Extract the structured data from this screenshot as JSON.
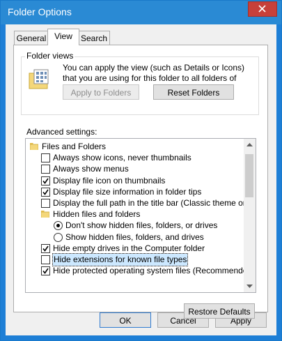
{
  "window": {
    "title": "Folder Options"
  },
  "tabs": [
    {
      "label": "General",
      "active": false
    },
    {
      "label": "View",
      "active": true
    },
    {
      "label": "Search",
      "active": false
    }
  ],
  "folder_views": {
    "legend": "Folder views",
    "description": "You can apply the view (such as Details or Icons) that you are using for this folder to all folders of this type.",
    "apply_label": "Apply to Folders",
    "reset_label": "Reset Folders"
  },
  "advanced": {
    "label": "Advanced settings:",
    "items": [
      {
        "kind": "folder",
        "level": 0,
        "label": "Files and Folders"
      },
      {
        "kind": "checkbox",
        "level": 1,
        "checked": false,
        "label": "Always show icons, never thumbnails"
      },
      {
        "kind": "checkbox",
        "level": 1,
        "checked": false,
        "label": "Always show menus"
      },
      {
        "kind": "checkbox",
        "level": 1,
        "checked": true,
        "label": "Display file icon on thumbnails"
      },
      {
        "kind": "checkbox",
        "level": 1,
        "checked": true,
        "label": "Display file size information in folder tips"
      },
      {
        "kind": "checkbox",
        "level": 1,
        "checked": false,
        "label": "Display the full path in the title bar (Classic theme only)"
      },
      {
        "kind": "folder",
        "level": 1,
        "label": "Hidden files and folders"
      },
      {
        "kind": "radio",
        "level": 2,
        "checked": true,
        "label": "Don't show hidden files, folders, or drives"
      },
      {
        "kind": "radio",
        "level": 2,
        "checked": false,
        "label": "Show hidden files, folders, and drives"
      },
      {
        "kind": "checkbox",
        "level": 1,
        "checked": true,
        "label": "Hide empty drives in the Computer folder"
      },
      {
        "kind": "checkbox",
        "level": 1,
        "checked": false,
        "label": "Hide extensions for known file types",
        "selected": true
      },
      {
        "kind": "checkbox",
        "level": 1,
        "checked": true,
        "label": "Hide protected operating system files (Recommended)"
      }
    ]
  },
  "restore_label": "Restore Defaults",
  "buttons": {
    "ok": "OK",
    "cancel": "Cancel",
    "apply": "Apply"
  },
  "colors": {
    "titlebar": "#2a8ad4",
    "close": "#c7403a",
    "selection": "#cce8ff"
  }
}
